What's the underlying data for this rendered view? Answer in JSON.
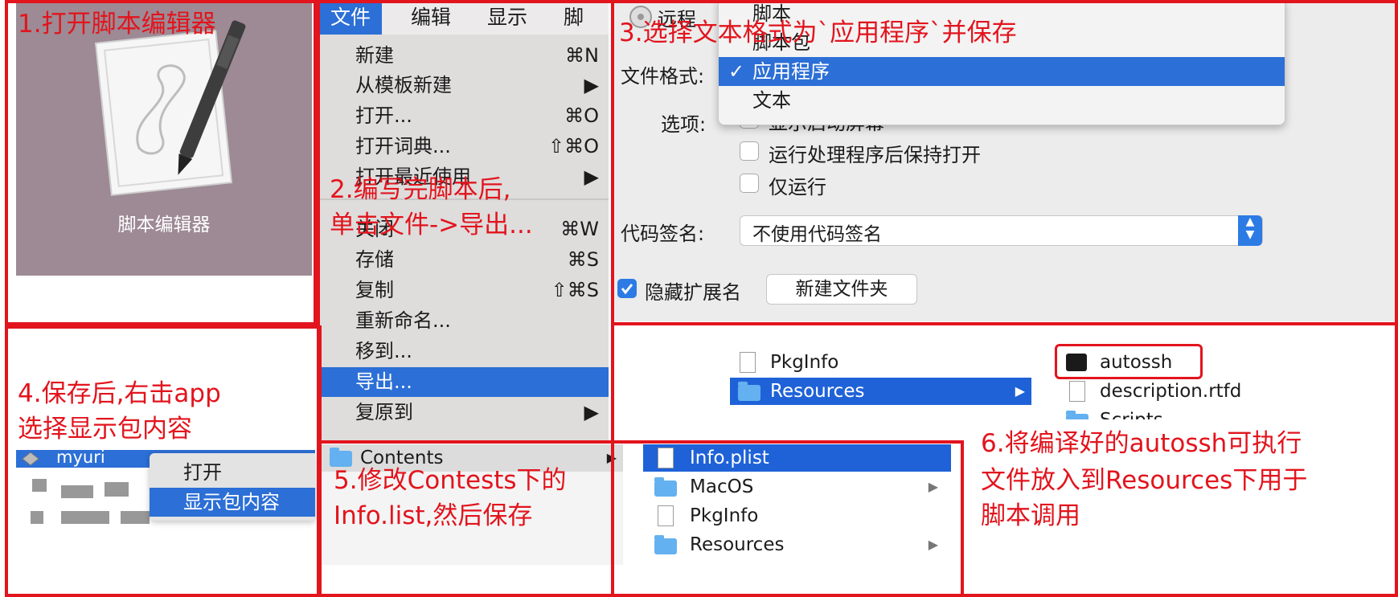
{
  "annotations": {
    "step1": "1.打开脚本编辑器",
    "step2_line1": "2.编写完脚本后,",
    "step2_line2": "单击文件->导出...",
    "step3": "3.选择文本格式为`应用程序`并保存",
    "step4_line1": "4.保存后,右击app",
    "step4_line2": "选择显示包内容",
    "step5_line1": "5.修改Contests下的",
    "step5_line2": "Info.list,然后保存",
    "step6_line1": "6.将编译好的autossh可执行",
    "step6_line2": "文件放入到Resources下用于",
    "step6_line3": "脚本调用"
  },
  "app_icon": {
    "caption": "脚本编辑器"
  },
  "menubar": [
    "文件",
    "编辑",
    "显示",
    "脚本"
  ],
  "file_menu": [
    {
      "label": "新建",
      "shortcut": "⌘N",
      "submenu": false
    },
    {
      "label": "从模板新建",
      "shortcut": "",
      "submenu": true
    },
    {
      "label": "打开...",
      "shortcut": "⌘O",
      "submenu": false
    },
    {
      "label": "打开词典...",
      "shortcut": "⇧⌘O",
      "submenu": false
    },
    {
      "label": "打开最近使用",
      "shortcut": "",
      "submenu": true
    },
    {
      "label": "关闭",
      "shortcut": "⌘W",
      "submenu": false
    },
    {
      "label": "存储",
      "shortcut": "⌘S",
      "submenu": false
    },
    {
      "label": "复制",
      "shortcut": "⇧⌘S",
      "submenu": false
    },
    {
      "label": "重新命名...",
      "shortcut": "",
      "submenu": false
    },
    {
      "label": "移到...",
      "shortcut": "",
      "submenu": false
    },
    {
      "label": "导出...",
      "shortcut": "",
      "submenu": false
    },
    {
      "label": "复原到",
      "shortcut": "",
      "submenu": true
    }
  ],
  "save_dialog": {
    "top_label": "远程",
    "format_label": "文件格式:",
    "options_label": "选项:",
    "format_options": [
      "脚本",
      "脚本包",
      "应用程序",
      "文本"
    ],
    "format_selected": "应用程序",
    "checkbox_show_startup": "显示启动屏幕",
    "checkbox_keep_open": "运行处理程序后保持打开",
    "checkbox_run_only": "仅运行",
    "codesign_label": "代码签名:",
    "codesign_value": "不使用代码签名",
    "hide_ext_label": "隐藏扩展名",
    "new_folder_button": "新建文件夹"
  },
  "resources_browser": {
    "left": [
      "PkgInfo",
      "Resources"
    ],
    "right": [
      "autossh",
      "description.rtfd",
      "Scripts"
    ]
  },
  "context_menu": {
    "app_name": "myuri",
    "items": [
      "打开",
      "显示包内容"
    ]
  },
  "contents_browser": {
    "left": [
      "Contents"
    ],
    "right": [
      "Info.plist",
      "MacOS",
      "PkgInfo",
      "Resources"
    ]
  }
}
